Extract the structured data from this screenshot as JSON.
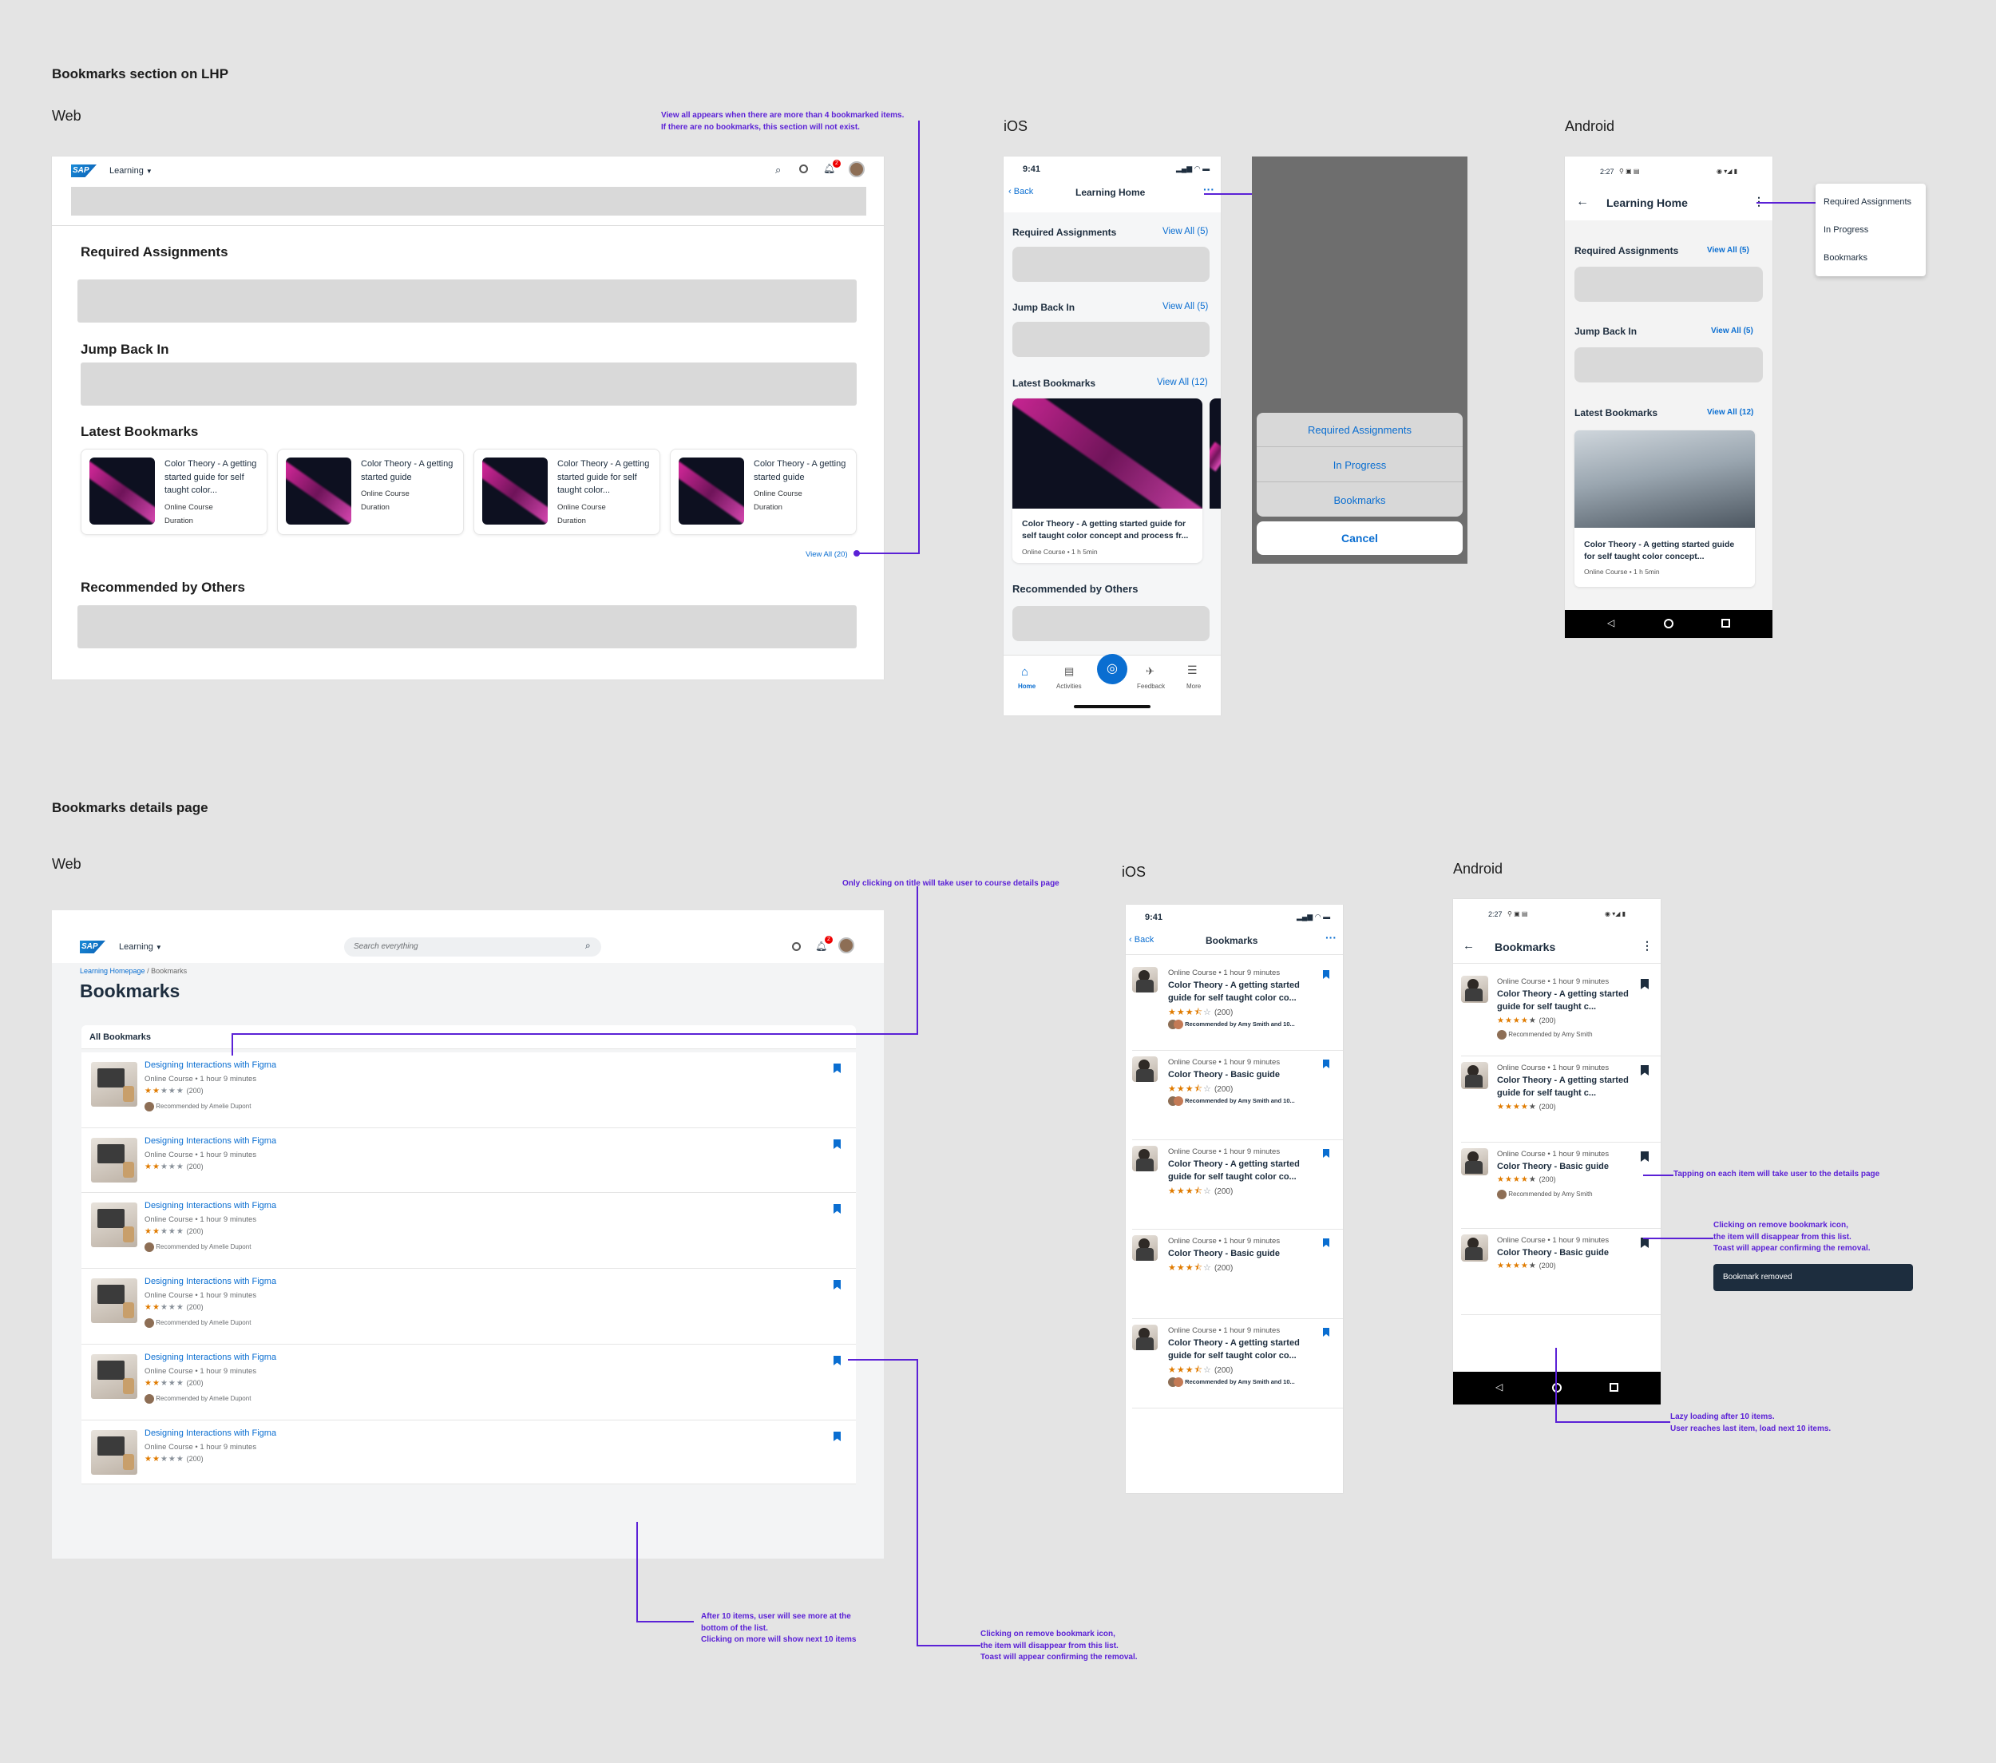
{
  "section1": {
    "title": "Bookmarks section on LHP",
    "web_label": "Web",
    "ios_label": "iOS",
    "android_label": "Android",
    "note_view_all": "View all appears when there are more than 4 bookmarked items.\nIf there are no bookmarks, this section will not exist.",
    "web": {
      "nav_title": "Learning",
      "sap_logo": "SAP",
      "notif_count": "2",
      "required_assignments": "Required Assignments",
      "jump_back_in": "Jump Back In",
      "latest_bookmarks": "Latest Bookmarks",
      "recommended_by_others": "Recommended by Others",
      "view_all": "View All (20)",
      "cards": [
        {
          "title": "Color Theory - A getting started guide for self taught color...",
          "type": "Online Course",
          "duration": "Duration"
        },
        {
          "title": "Color Theory - A getting started guide",
          "type": "Online Course",
          "duration": "Duration"
        },
        {
          "title": "Color Theory - A getting started guide for self taught color...",
          "type": "Online Course",
          "duration": "Duration"
        },
        {
          "title": "Color Theory - A getting started guide",
          "type": "Online Course",
          "duration": "Duration"
        }
      ]
    },
    "ios": {
      "time": "9:41",
      "back": "Back",
      "title": "Learning Home",
      "required_assignments": "Required Assignments",
      "required_view_all": "View All (5)",
      "jump_back_in": "Jump Back In",
      "jump_view_all": "View All (5)",
      "latest_bookmarks": "Latest Bookmarks",
      "latest_view_all": "View All (12)",
      "card_title": "Color Theory - A getting started guide for self taught color concept and process fr...",
      "card_meta": "Online Course  •  1 h 5min",
      "recommended_by_others": "Recommended by Others",
      "tabs": [
        "Home",
        "Activities",
        "",
        "Feedback",
        "More"
      ],
      "sheet_options": [
        "Required Assignments",
        "In Progress",
        "Bookmarks"
      ],
      "sheet_cancel": "Cancel"
    },
    "android": {
      "time": "2:27",
      "title": "Learning Home",
      "required_assignments": "Required Assignments",
      "required_view_all": "View All (5)",
      "jump_back_in": "Jump Back In",
      "jump_view_all": "View All (5)",
      "latest_bookmarks": "Latest Bookmarks",
      "latest_view_all": "View All (12)",
      "card_title": "Color Theory - A getting started guide for self taught color concept...",
      "card_meta": "Online Course  •  1 h 5min",
      "menu": [
        "Required Assignments",
        "In Progress",
        "Bookmarks"
      ]
    }
  },
  "section2": {
    "title": "Bookmarks details page",
    "web_label": "Web",
    "ios_label": "iOS",
    "android_label": "Android",
    "note_title_click": "Only clicking on title will take user to course details page",
    "note_more": "After 10 items, user will see more at the\nbottom of the list.\nClicking on more will show next 10 items",
    "note_remove": "Clicking on remove bookmark icon,\nthe item will disappear from this list.\nToast will appear confirming the removal.",
    "note_tap": "Tapping on each item will take user to the details page",
    "note_remove_android": "Clicking on remove bookmark icon,\nthe item will disappear from this list.\nToast will appear confirming the removal.",
    "note_lazy": "Lazy loading after 10 items.\nUser reaches last item, load next 10 items.",
    "toast": "Bookmark removed",
    "web": {
      "nav_title": "Learning",
      "sap_logo": "SAP",
      "search_placeholder": "Search everything",
      "notif_count": "2",
      "breadcrumb_home": "Learning Homepage",
      "breadcrumb_sep": " / ",
      "breadcrumb_current": "Bookmarks",
      "page_title": "Bookmarks",
      "list_header": "All Bookmarks",
      "items": [
        {
          "title": "Designing Interactions with Figma",
          "meta": "Online Course • 1 hour 9 minutes",
          "rating": "(200)",
          "rec": "Recommended by Amelie Dupont"
        },
        {
          "title": "Designing Interactions with Figma",
          "meta": "Online Course • 1 hour 9 minutes",
          "rating": "(200)",
          "rec": ""
        },
        {
          "title": "Designing Interactions with Figma",
          "meta": "Online Course • 1 hour 9 minutes",
          "rating": "(200)",
          "rec": "Recommended by Amelie Dupont"
        },
        {
          "title": "Designing Interactions with Figma",
          "meta": "Online Course • 1 hour 9 minutes",
          "rating": "(200)",
          "rec": "Recommended by Amelie Dupont"
        },
        {
          "title": "Designing Interactions with Figma",
          "meta": "Online Course • 1 hour 9 minutes",
          "rating": "(200)",
          "rec": "Recommended by Amelie Dupont"
        },
        {
          "title": "Designing Interactions with Figma",
          "meta": "Online Course • 1 hour 9 minutes",
          "rating": "(200)",
          "rec": ""
        }
      ]
    },
    "ios": {
      "time": "9:41",
      "back": "Back",
      "title": "Bookmarks",
      "items": [
        {
          "meta": "Online Course • 1 hour 9 minutes",
          "title": "Color Theory - A getting started guide for self taught color co...",
          "rating": "(200)",
          "rec": "Recommended by Amy Smith and 10..."
        },
        {
          "meta": "Online Course • 1 hour 9 minutes",
          "title": "Color Theory - Basic guide",
          "rating": "(200)",
          "rec": "Recommended by Amy Smith and 10..."
        },
        {
          "meta": "Online Course • 1 hour 9 minutes",
          "title": "Color Theory - A getting started guide for self taught color co...",
          "rating": "(200)",
          "rec": ""
        },
        {
          "meta": "Online Course • 1 hour 9 minutes",
          "title": "Color Theory - Basic guide",
          "rating": "(200)",
          "rec": ""
        },
        {
          "meta": "Online Course • 1 hour 9 minutes",
          "title": "Color Theory - A getting started guide for self taught color co...",
          "rating": "(200)",
          "rec": "Recommended by Amy Smith and 10..."
        }
      ]
    },
    "android": {
      "time": "2:27",
      "title": "Bookmarks",
      "items": [
        {
          "meta": "Online Course • 1 hour 9 minutes",
          "title": "Color Theory - A getting started guide for self taught c...",
          "rating": "(200)",
          "rec": "Recommended by Amy Smith"
        },
        {
          "meta": "Online Course • 1 hour 9 minutes",
          "title": "Color Theory - A getting started guide for self taught c...",
          "rating": "(200)",
          "rec": ""
        },
        {
          "meta": "Online Course • 1 hour 9 minutes",
          "title": "Color Theory - Basic guide",
          "rating": "(200)",
          "rec": "Recommended by Amy Smith"
        },
        {
          "meta": "Online Course • 1 hour 9 minutes",
          "title": "Color Theory - Basic guide",
          "rating": "(200)",
          "rec": ""
        }
      ]
    }
  },
  "colors": {
    "accent": "#0a6ed1",
    "annotation": "#5b21d6",
    "star": "#e07b00",
    "background": "#e4e4e4"
  }
}
